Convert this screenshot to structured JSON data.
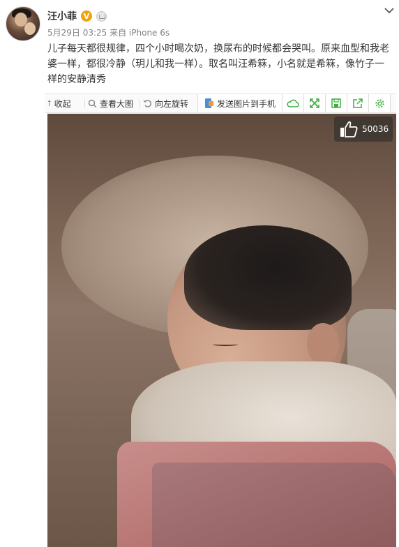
{
  "post": {
    "author": "汪小菲",
    "verified_badge": "V",
    "meta": "5月29日 03:25 来自 iPhone 6s",
    "text": "儿子每天都很规律，四个小时喝次奶，换尿布的时候都会哭叫。原来血型和我老婆一样，都很冷静（玥儿和我一样）。取名叫汪希箖，小名就是希箖，像竹子一样的安静清秀"
  },
  "toolbar": {
    "collapse_label": "收起",
    "view_large_label": "查看大图",
    "rotate_left_label": "向左旋转",
    "send_to_phone_label": "发送图片到手机",
    "icons": [
      "cloud-icon",
      "fullscreen-icon",
      "save-icon",
      "share-icon",
      "gear-icon"
    ]
  },
  "photo": {
    "like_count": "50036"
  },
  "colors": {
    "accent_green": "#3dae3d",
    "badge_orange": "#f0a40a",
    "meta_gray": "#808080"
  }
}
